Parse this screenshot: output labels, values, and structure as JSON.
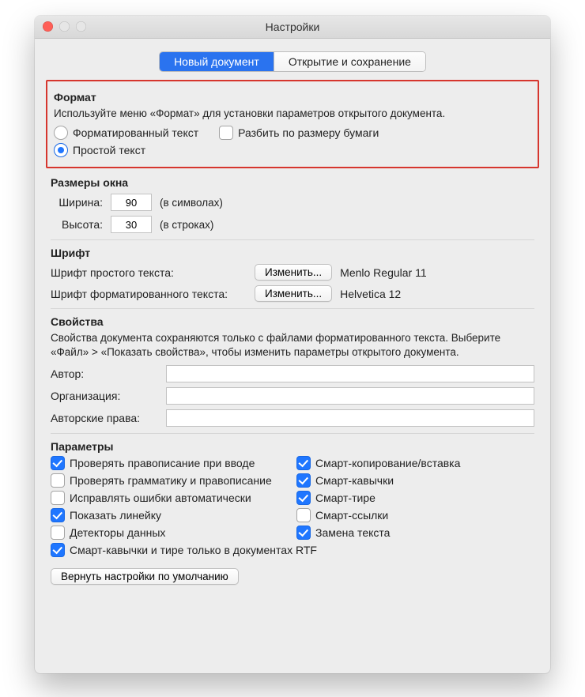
{
  "window": {
    "title": "Настройки"
  },
  "tabs": {
    "new_doc": "Новый документ",
    "open_save": "Открытие и сохранение"
  },
  "format": {
    "heading": "Формат",
    "help": "Используйте меню «Формат» для установки параметров открытого документа.",
    "rich_text": "Форматированный текст",
    "wrap_to_page": "Разбить по размеру бумаги",
    "plain_text": "Простой текст"
  },
  "window_size": {
    "heading": "Размеры окна",
    "width_label": "Ширина:",
    "width_value": "90",
    "width_suffix": "(в символах)",
    "height_label": "Высота:",
    "height_value": "30",
    "height_suffix": "(в строках)"
  },
  "font": {
    "heading": "Шрифт",
    "plain_label": "Шрифт простого текста:",
    "rich_label": "Шрифт форматированного текста:",
    "change_btn": "Изменить...",
    "plain_value": "Menlo Regular 11",
    "rich_value": "Helvetica 12"
  },
  "props": {
    "heading": "Свойства",
    "help": "Свойства документа сохраняются только с файлами форматированного текста. Выберите «Файл» > «Показать свойства», чтобы изменить параметры открытого документа.",
    "author": "Автор:",
    "org": "Организация:",
    "copyright": "Авторские права:"
  },
  "params": {
    "heading": "Параметры",
    "spellcheck": "Проверять правописание при вводе",
    "grammar": "Проверять грамматику и правописание",
    "autocorrect": "Исправлять ошибки автоматически",
    "ruler": "Показать линейку",
    "data_detectors": "Детекторы данных",
    "smart_copy": "Смарт-копирование/вставка",
    "smart_quotes": "Смарт-кавычки",
    "smart_dashes": "Смарт-тире",
    "smart_links": "Смарт-ссылки",
    "text_replace": "Замена текста",
    "rtf_only": "Смарт-кавычки и тире только в документах RTF"
  },
  "restore_defaults": "Вернуть настройки по умолчанию"
}
